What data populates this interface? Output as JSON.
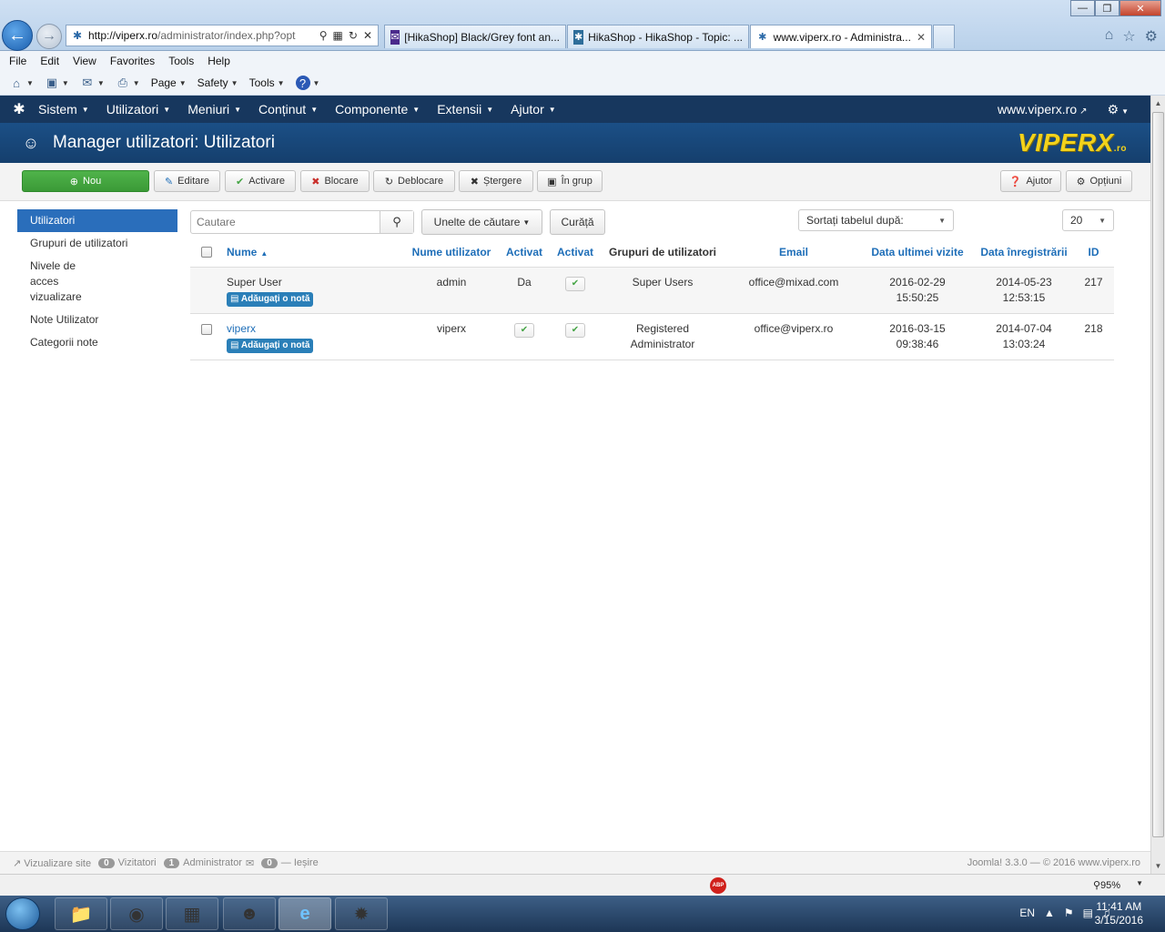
{
  "browser": {
    "address_host": "http://viperx.ro",
    "address_rest": "/administrator/index.php?opt",
    "tabs": [
      {
        "label": "[HikaShop] Black/Grey font an..."
      },
      {
        "label": "HikaShop - HikaShop - Topic: ..."
      },
      {
        "label": "www.viperx.ro - Administra..."
      }
    ],
    "menu": [
      "File",
      "Edit",
      "View",
      "Favorites",
      "Tools",
      "Help"
    ],
    "commands": {
      "page": "Page",
      "safety": "Safety",
      "tools": "Tools"
    }
  },
  "joomla": {
    "nav": [
      "Sistem",
      "Utilizatori",
      "Meniuri",
      "Conținut",
      "Componente",
      "Extensii",
      "Ajutor"
    ],
    "site_link": "www.viperx.ro",
    "page_title": "Manager utilizatori: Utilizatori",
    "brand": {
      "main": "VIPERX",
      "suffix": ".ro"
    },
    "toolbar": {
      "new": "Nou",
      "edit": "Editare",
      "activate": "Activare",
      "block": "Blocare",
      "unblock": "Deblocare",
      "delete": "Ștergere",
      "group": "În grup",
      "help": "Ajutor",
      "options": "Opțiuni"
    },
    "sidebar": [
      {
        "label": "Utilizatori",
        "active": true
      },
      {
        "label": "Grupuri de utilizatori"
      },
      {
        "label": "Nivele de acces vizualizare"
      },
      {
        "label": "Note Utilizator"
      },
      {
        "label": "Categorii note"
      }
    ],
    "search": {
      "placeholder": "Cautare"
    },
    "filters": {
      "tools": "Unelte de căutare",
      "clear": "Curăță",
      "sort": "Sortați tabelul după:",
      "limit": "20"
    },
    "table": {
      "headers": {
        "name": "Nume",
        "username": "Nume utilizator",
        "enabled": "Activat",
        "activated": "Activat",
        "groups": "Grupuri de utilizatori",
        "email": "Email",
        "last_visit": "Data ultimei vizite",
        "registered": "Data înregistrării",
        "id": "ID"
      },
      "add_note_label": "Adăugați o notă",
      "rows": [
        {
          "name": "Super User",
          "username": "admin",
          "enabled": "Da",
          "activated": "yes",
          "group1": "Super Users",
          "group2": "",
          "email": "office@mixad.com",
          "last_visit_date": "2016-02-29",
          "last_visit_time": "15:50:25",
          "registered_date": "2014-05-23",
          "registered_time": "12:53:15",
          "id": "217"
        },
        {
          "name": "viperx",
          "username": "viperx",
          "enabled": "yes",
          "activated": "yes",
          "group1": "Registered",
          "group2": "Administrator",
          "email": "office@viperx.ro",
          "last_visit_date": "2016-03-15",
          "last_visit_time": "09:38:46",
          "registered_date": "2014-07-04",
          "registered_time": "13:03:24",
          "id": "218"
        }
      ]
    },
    "footer": {
      "view_site": "Vizualizare site",
      "visitors_count": "0",
      "visitors": "Vizitatori",
      "admins_count": "1",
      "admins": "Administrator",
      "messages_count": "0",
      "logout": "Ieșire",
      "copyright": "Joomla! 3.3.0 — © 2016 www.viperx.ro"
    }
  },
  "status": {
    "adblock": "ABP",
    "zoom": "95%"
  },
  "taskbar": {
    "lang": "EN",
    "time": "11:41 AM",
    "date": "3/15/2016"
  }
}
